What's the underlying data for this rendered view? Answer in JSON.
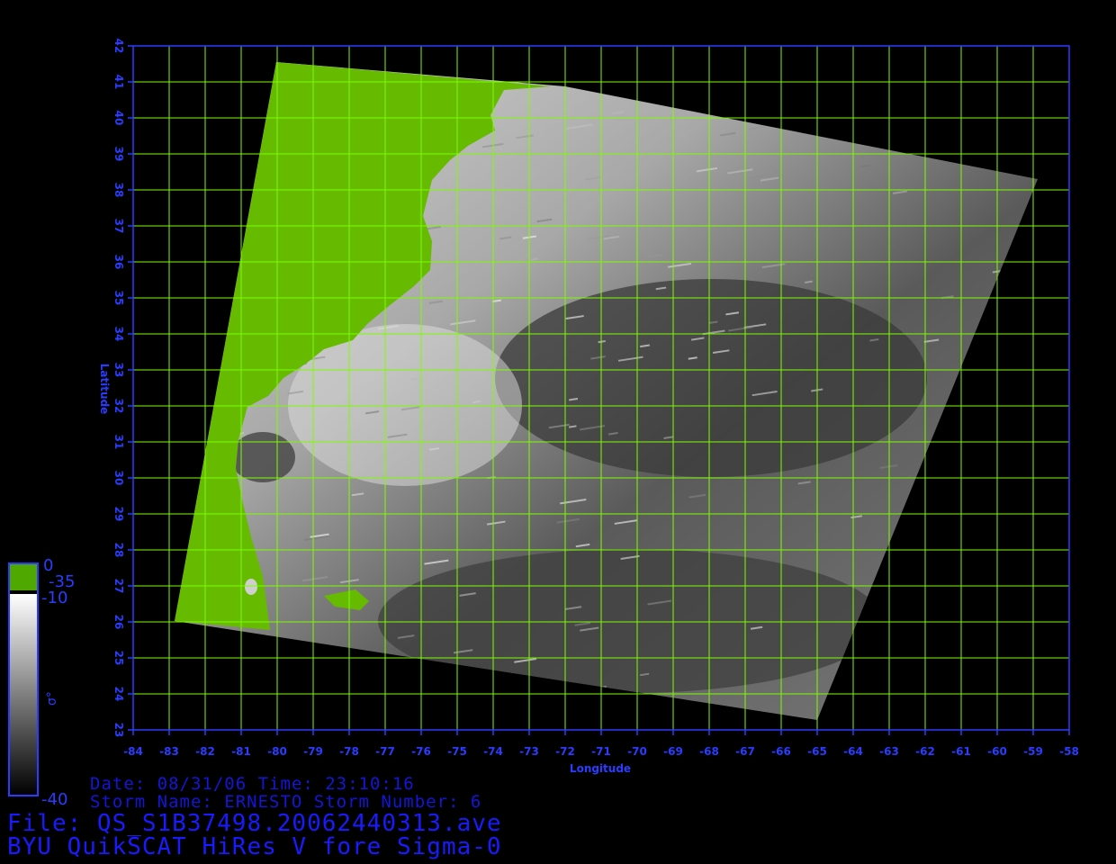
{
  "map": {
    "lon_ticks": [
      -84,
      -83,
      -82,
      -81,
      -80,
      -79,
      -78,
      -77,
      -76,
      -75,
      -74,
      -73,
      -72,
      -71,
      -70,
      -69,
      -68,
      -67,
      -66,
      -65,
      -64,
      -63,
      -62,
      -61,
      -60,
      -59,
      -58
    ],
    "lat_ticks": [
      23,
      24,
      25,
      26,
      27,
      28,
      29,
      30,
      31,
      32,
      33,
      34,
      35,
      36,
      37,
      38,
      39,
      40,
      41,
      42
    ],
    "lon_range": [
      -84,
      -58
    ],
    "lat_range": [
      23,
      42
    ],
    "x_label": "Longitude",
    "y_label": "Latitude",
    "grid_color": "#7cfc00",
    "axis_color": "#2a3cff",
    "land_color": "#66bb00"
  },
  "colorbar": {
    "ticks": [
      "0",
      "-35",
      "-10",
      "-40"
    ],
    "symbol": "σ°",
    "land_color": "#4fa800"
  },
  "info": {
    "date_line": "Date: 08/31/06   Time: 23:10:16",
    "storm_line": "Storm Name: ERNESTO   Storm Number: 6",
    "file_line": "File: QS_S1B37498.20062440313.ave",
    "product_line": "BYU QuikSCAT HiRes V fore Sigma-0"
  }
}
